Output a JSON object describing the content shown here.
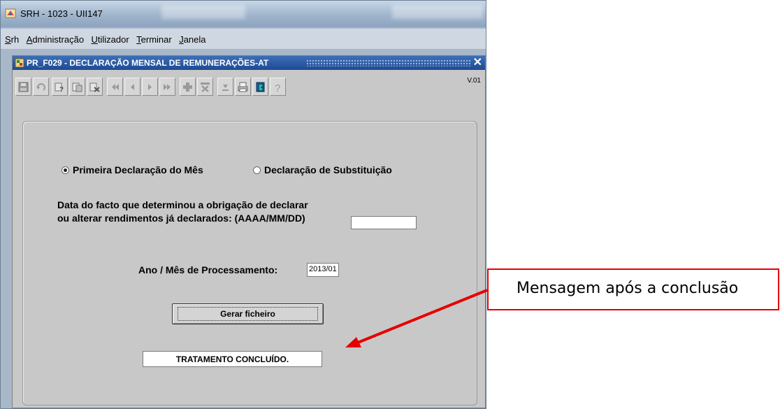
{
  "app": {
    "title": "SRH  - 1023 - UII147"
  },
  "menu": {
    "items": [
      {
        "first": "S",
        "rest": "rh"
      },
      {
        "first": "A",
        "rest": "dministração"
      },
      {
        "first": "U",
        "rest": "tilizador"
      },
      {
        "first": "T",
        "rest": "erminar"
      },
      {
        "first": "J",
        "rest": "anela"
      }
    ]
  },
  "form": {
    "title": "PR_F029 - DECLARAÇÃO MENSAL DE REMUNERAÇÕES-AT",
    "close_glyph": "✕",
    "version": "V.01"
  },
  "toolbar": {
    "icons": [
      "save-icon",
      "undo-icon",
      "query-icon",
      "execute-query-icon",
      "cancel-query-icon",
      "first-record-icon",
      "previous-record-icon",
      "next-record-icon",
      "last-record-icon",
      "insert-record-icon",
      "delete-record-icon",
      "list-values-icon",
      "print-icon",
      "exit-icon",
      "help-icon"
    ]
  },
  "declaration": {
    "option_first": "Primeira Declaração do Mês",
    "option_substitution": "Declaração de Substituição",
    "selected": "first",
    "fact_label_line1": "Data do facto que determinou a obrigação de declarar",
    "fact_label_line2": "ou alterar rendimentos já declarados: (AAAA/MM/DD)",
    "fact_date_value": "",
    "period_label": "Ano / Mês de Processamento:",
    "period_value": "2013/01",
    "generate_button": "Gerar ficheiro",
    "status_message": "TRATAMENTO CONCLUÍDO."
  },
  "annotation": {
    "callout_text": "Mensagem após a conclusão",
    "color": "#e60000"
  }
}
